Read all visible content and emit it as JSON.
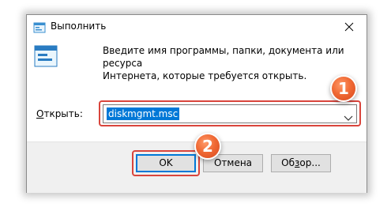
{
  "window": {
    "title": "Выполнить",
    "icon": "run-icon",
    "close_icon": "close-icon"
  },
  "main": {
    "description_line1": "Введите имя программы, папки, документа или ресурса",
    "description_line2": "Интернета, которые требуется открыть.",
    "open_label_underlined": "О",
    "open_label_rest": "ткрыть:",
    "combo_value": "diskmgmt.msc",
    "combo_arrow_icon": "chevron-down-icon"
  },
  "buttons": {
    "ok_label": "OK",
    "cancel_label": "Отмена",
    "browse_label_pre": "Об",
    "browse_label_underlined": "з",
    "browse_label_post": "ор..."
  },
  "annotations": {
    "badge1": "1",
    "badge2": "2",
    "accent_color": "#d9453c"
  },
  "colors": {
    "selection": "#0078d7",
    "footer": "#f0f0f0"
  }
}
